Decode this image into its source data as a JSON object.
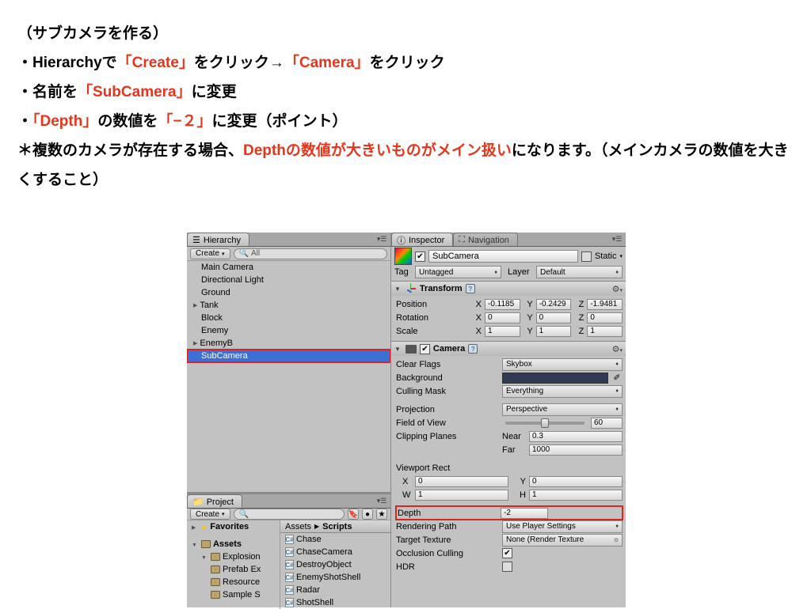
{
  "tutorial": {
    "title_open": "（",
    "title": "サブカメラを作る",
    "title_close": "）",
    "l1a": "・Hierarchyで",
    "l1b": "「Create」",
    "l1c": "をクリック→",
    "l1d": "「Camera」",
    "l1e": "をクリック",
    "l2a": "・名前を",
    "l2b": "「SubCamera」",
    "l2c": "に変更",
    "l3a": "・",
    "l3b": "「Depth」",
    "l3c": "の数値を",
    "l3d": "「−２」",
    "l3e": "に変更（ポイント）",
    "l4a": "＊複数のカメラが存在する場合、",
    "l4b": "Depthの数値が大きいものがメイン扱い",
    "l4c": "になります。（メインカメラの数値を大きくすること）"
  },
  "hierarchy": {
    "tab": "Hierarchy",
    "create": "Create",
    "search_placeholder": "All",
    "items": [
      "Main Camera",
      "Directional Light",
      "Ground",
      "Tank",
      "Block",
      "Enemy",
      "EnemyB",
      "SubCamera"
    ]
  },
  "project": {
    "tab": "Project",
    "create": "Create",
    "favorites": "Favorites",
    "assets": "Assets",
    "explosion": "Explosion",
    "prefab": "Prefab Ex",
    "resource": "Resource",
    "sample": "Sample S",
    "crumb1": "Assets",
    "crumb2": "Scripts",
    "scripts": [
      "Chase",
      "ChaseCamera",
      "DestroyObject",
      "EnemyShotShell",
      "Radar",
      "ShotShell"
    ]
  },
  "inspector": {
    "tab": "Inspector",
    "nav": "Navigation",
    "name": "SubCamera",
    "static": "Static",
    "tag_lbl": "Tag",
    "tag": "Untagged",
    "layer_lbl": "Layer",
    "layer": "Default",
    "transform": "Transform",
    "position": "Position",
    "rotation": "Rotation",
    "scale": "Scale",
    "pos": {
      "x": "-0.1185",
      "y": "-0.2429",
      "z": "-1.9481"
    },
    "rot": {
      "x": "0",
      "y": "0",
      "z": "0"
    },
    "scl": {
      "x": "1",
      "y": "1",
      "z": "1"
    },
    "camera": "Camera",
    "clearflags": "Clear Flags",
    "clearflags_v": "Skybox",
    "background": "Background",
    "culling": "Culling Mask",
    "culling_v": "Everything",
    "projection": "Projection",
    "projection_v": "Perspective",
    "fov": "Field of View",
    "fov_v": "60",
    "clip": "Clipping Planes",
    "near": "Near",
    "near_v": "0.3",
    "far": "Far",
    "far_v": "1000",
    "viewport": "Viewport Rect",
    "vx": "0",
    "vy": "0",
    "vw": "1",
    "vh": "1",
    "depth": "Depth",
    "depth_v": "-2",
    "render": "Rendering Path",
    "render_v": "Use Player Settings",
    "target": "Target Texture",
    "target_v": "None (Render Texture",
    "occ": "Occlusion Culling",
    "hdr": "HDR"
  }
}
